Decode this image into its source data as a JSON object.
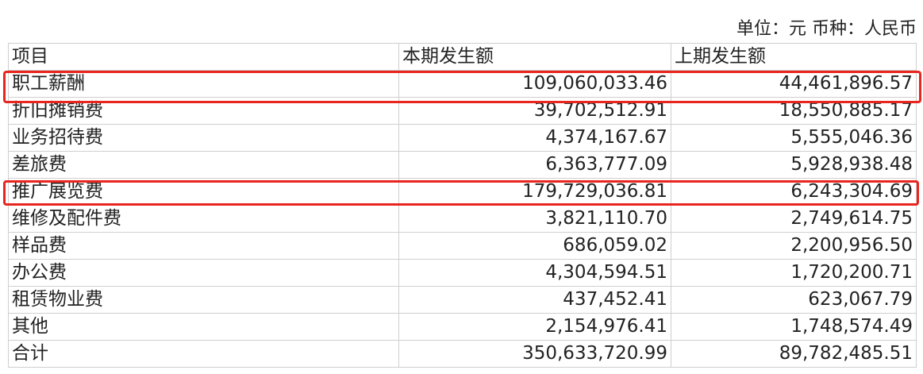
{
  "unit_label": "单位：元 币种：人民币",
  "table": {
    "headers": [
      "项目",
      "本期发生额",
      "上期发生额"
    ],
    "rows": [
      {
        "item": "职工薪酬",
        "current": "109,060,033.46",
        "previous": "44,461,896.57",
        "highlighted": true
      },
      {
        "item": "折旧摊销费",
        "current": "39,702,512.91",
        "previous": "18,550,885.17"
      },
      {
        "item": "业务招待费",
        "current": "4,374,167.67",
        "previous": "5,555,046.36"
      },
      {
        "item": "差旅费",
        "current": "6,363,777.09",
        "previous": "5,928,938.48"
      },
      {
        "item": "推广展览费",
        "current": "179,729,036.81",
        "previous": "6,243,304.69",
        "highlighted": true
      },
      {
        "item": "维修及配件费",
        "current": "3,821,110.70",
        "previous": "2,749,614.75"
      },
      {
        "item": "样品费",
        "current": "686,059.02",
        "previous": "2,200,956.50"
      },
      {
        "item": "办公费",
        "current": "4,304,594.51",
        "previous": "1,720,200.71"
      },
      {
        "item": "租赁物业费",
        "current": "437,452.41",
        "previous": "623,067.79"
      },
      {
        "item": "其他",
        "current": "2,154,976.41",
        "previous": "1,748,574.49"
      },
      {
        "item": "合计",
        "current": "350,633,720.99",
        "previous": "89,782,485.51"
      }
    ]
  },
  "highlight_color": "#e8251f"
}
